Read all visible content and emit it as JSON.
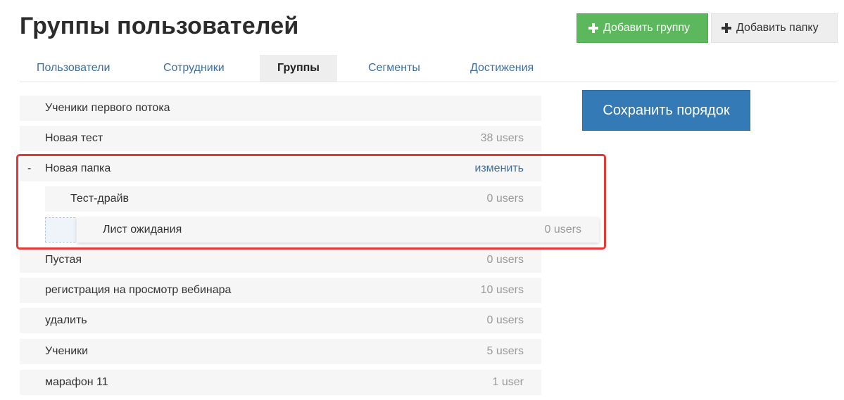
{
  "header": {
    "title": "Группы пользователей",
    "add_group_label": "Добавить группу",
    "add_folder_label": "Добавить папку"
  },
  "tabs": [
    {
      "label": "Пользователи",
      "active": false
    },
    {
      "label": "Сотрудники",
      "active": false
    },
    {
      "label": "Группы",
      "active": true
    },
    {
      "label": "Сегменты",
      "active": false
    },
    {
      "label": "Достижения",
      "active": false
    }
  ],
  "save_order_label": "Сохранить порядок",
  "groups": {
    "row1": {
      "name": "Ученики первого потока",
      "count": ""
    },
    "row2": {
      "name": "Новая тест",
      "count": "38 users"
    },
    "folder": {
      "toggle": "-",
      "name": "Новая папка",
      "edit_label": "изменить",
      "children": [
        {
          "name": "Тест-драйв",
          "count": "0 users"
        }
      ]
    },
    "dragging": {
      "name": "Лист ожидания",
      "count": "0 users"
    },
    "row3": {
      "name": "Пустая",
      "count": "0 users"
    },
    "row4": {
      "name": "регистрация на просмотр вебинара",
      "count": "10 users"
    },
    "row5": {
      "name": "удалить",
      "count": "0 users"
    },
    "row6": {
      "name": "Ученики",
      "count": "5 users"
    },
    "row7": {
      "name": "марафон 11",
      "count": "1 user"
    }
  },
  "colors": {
    "add_group_bg": "#5cb85c",
    "save_bg": "#337ab7",
    "highlight": "#e53935",
    "link": "#3f6f9e"
  }
}
